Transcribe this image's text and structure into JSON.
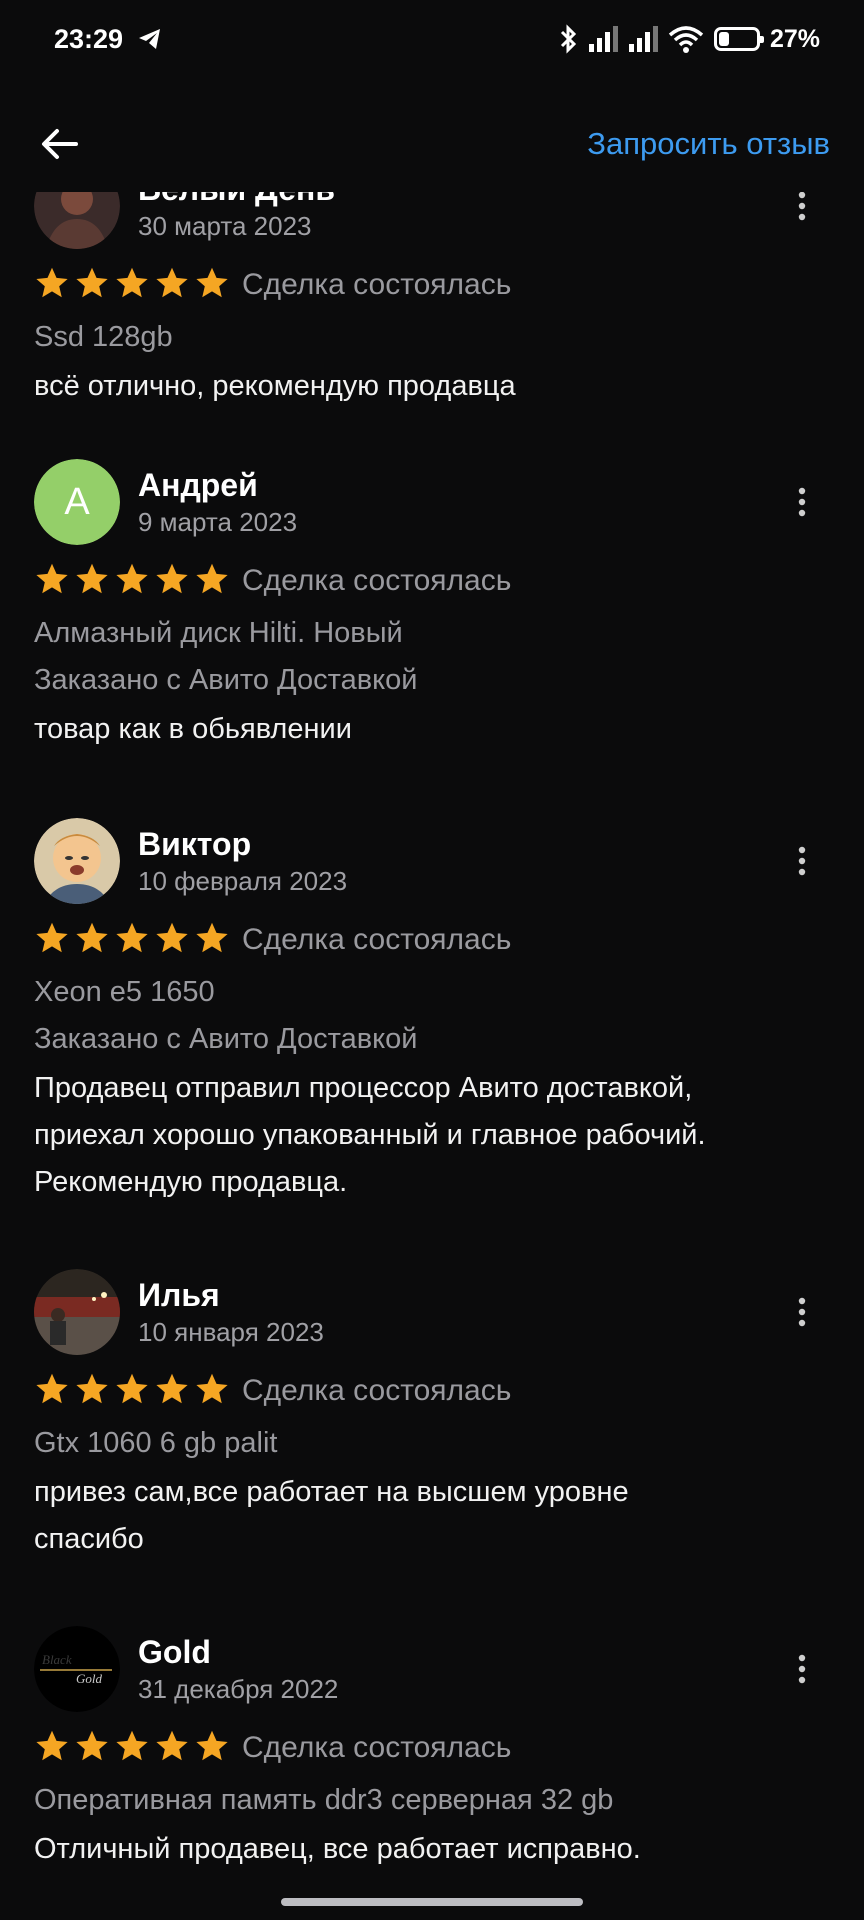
{
  "status_bar": {
    "time": "23:29",
    "battery_text": "27%",
    "battery_level": 0.27,
    "icons": [
      "telegram-icon",
      "bluetooth-icon",
      "signal-icon",
      "signal-icon",
      "wifi-icon",
      "battery-icon"
    ]
  },
  "app_bar": {
    "back_icon": "arrow-left-icon",
    "request_review_label": "Запросить отзыв"
  },
  "colors": {
    "accent": "#3d9bf0",
    "star": "#f5a623",
    "background": "#0b0b0c",
    "secondary_text": "#9a9a9f"
  },
  "reviews": [
    {
      "name": "Белый День",
      "date": "30 марта 2023",
      "rating": 5,
      "deal_status": "Сделка состоялась",
      "item": "Ssd 128gb",
      "delivery": "",
      "comment_lines": [
        "всё отлично, рекомендую продавца"
      ],
      "avatar": "photo"
    },
    {
      "name": "Андрей",
      "date": "9 марта 2023",
      "rating": 5,
      "deal_status": "Сделка состоялась",
      "item": "Алмазный диск Hilti. Новый",
      "delivery": "Заказано с Авито Доставкой",
      "comment_lines": [
        "товар как в обьявлении"
      ],
      "avatar": "letter",
      "avatar_letter": "А",
      "avatar_color": "#94cf69"
    },
    {
      "name": "Виктор",
      "date": "10 февраля 2023",
      "rating": 5,
      "deal_status": "Сделка состоялась",
      "item": "Xeon e5 1650",
      "delivery": "Заказано с Авито Доставкой",
      "comment_lines": [
        "Продавец отправил процессор Авито доставкой,",
        "приехал хорошо упакованный и главное рабочий.",
        "Рекомендую продавца."
      ],
      "avatar": "cartoon"
    },
    {
      "name": "Илья",
      "date": "10 января 2023",
      "rating": 5,
      "deal_status": "Сделка состоялась",
      "item": "Gtx 1060 6 gb palit",
      "delivery": "",
      "comment_lines": [
        "привез сам,все работает на высшем уровне",
        "спасибо"
      ],
      "avatar": "photo-night"
    },
    {
      "name": "Gold",
      "date": "31 декабря 2022",
      "rating": 5,
      "deal_status": "Сделка состоялась",
      "item": "Оперативная память ddr3 серверная 32 gb",
      "delivery": "",
      "comment_lines": [
        "Отличный продавец, все работает исправно."
      ],
      "avatar": "logo",
      "avatar_logo_text": [
        "Black",
        "Gold"
      ]
    }
  ]
}
